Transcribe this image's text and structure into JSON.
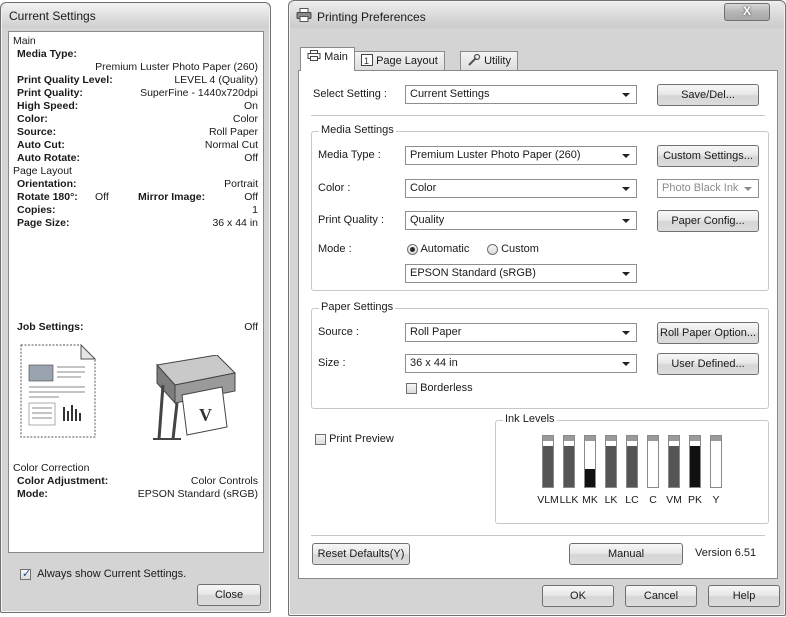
{
  "current_settings": {
    "title": "Current Settings",
    "main_label": "Main",
    "media_type_label": "Media Type:",
    "media_type_value": "Premium Luster Photo Paper (260)",
    "rows": [
      {
        "k": "Print Quality Level:",
        "v": "LEVEL 4 (Quality)"
      },
      {
        "k": "Print Quality:",
        "v": "SuperFine - 1440x720dpi"
      },
      {
        "k": "High Speed:",
        "v": "On"
      },
      {
        "k": "Color:",
        "v": "Color"
      },
      {
        "k": "Source:",
        "v": "Roll Paper"
      },
      {
        "k": "Auto Cut:",
        "v": "Normal Cut"
      },
      {
        "k": "Auto Rotate:",
        "v": "Off"
      }
    ],
    "page_layout_label": "Page Layout",
    "orientation_label": "Orientation:",
    "orientation_value": "Portrait",
    "rotate_label": "Rotate 180°:",
    "rotate_value": "Off",
    "mirror_label": "Mirror Image:",
    "mirror_value": "Off",
    "copies_label": "Copies:",
    "copies_value": "1",
    "page_size_label": "Page Size:",
    "page_size_value": "36 x 44 in",
    "job_settings_label": "Job Settings:",
    "job_settings_value": "Off",
    "color_correction_label": "Color Correction",
    "color_adjustment_label": "Color Adjustment:",
    "color_adjustment_value": "Color Controls",
    "mode_label": "Mode:",
    "mode_value": "EPSON Standard (sRGB)",
    "always_show_label": "Always show Current Settings.",
    "always_show_checked": true,
    "close_label": "Close"
  },
  "printing_prefs": {
    "title": "Printing Preferences",
    "close_glyph": "X",
    "tabs": [
      {
        "label": "Main"
      },
      {
        "label": "Page Layout"
      },
      {
        "label": "Utility"
      }
    ],
    "select_setting_label": "Select Setting :",
    "select_setting_value": "Current Settings",
    "save_del_label": "Save/Del...",
    "media_group_title": "Media Settings",
    "media_type_label": "Media Type :",
    "media_type_value": "Premium Luster Photo Paper (260)",
    "custom_settings_label": "Custom Settings...",
    "color_label": "Color :",
    "color_value": "Color",
    "ink_combo_value": "Photo Black Ink",
    "print_quality_label": "Print Quality :",
    "print_quality_value": "Quality",
    "paper_config_label": "Paper Config...",
    "mode_label": "Mode :",
    "mode_automatic": "Automatic",
    "mode_custom": "Custom",
    "mode_profile_value": "EPSON Standard (sRGB)",
    "paper_group_title": "Paper Settings",
    "source_label": "Source :",
    "source_value": "Roll Paper",
    "roll_paper_option_label": "Roll Paper Option...",
    "size_label": "Size :",
    "size_value": "36 x 44 in",
    "user_defined_label": "User Defined...",
    "borderless_label": "Borderless",
    "print_preview_label": "Print Preview",
    "ink_levels_title": "Ink Levels",
    "inks": [
      {
        "name": "VLM",
        "level": 0.9
      },
      {
        "name": "LLK",
        "level": 0.9
      },
      {
        "name": "MK",
        "level": 0.4
      },
      {
        "name": "LK",
        "level": 0.9
      },
      {
        "name": "LC",
        "level": 0.9
      },
      {
        "name": "C",
        "level": 0.0
      },
      {
        "name": "VM",
        "level": 0.9
      },
      {
        "name": "PK",
        "level": 0.9
      },
      {
        "name": "Y",
        "level": 0.0
      }
    ],
    "reset_defaults_label": "Reset Defaults(Y)",
    "manual_label": "Manual",
    "version_label": "Version 6.51",
    "ok_label": "OK",
    "cancel_label": "Cancel",
    "help_label": "Help"
  }
}
